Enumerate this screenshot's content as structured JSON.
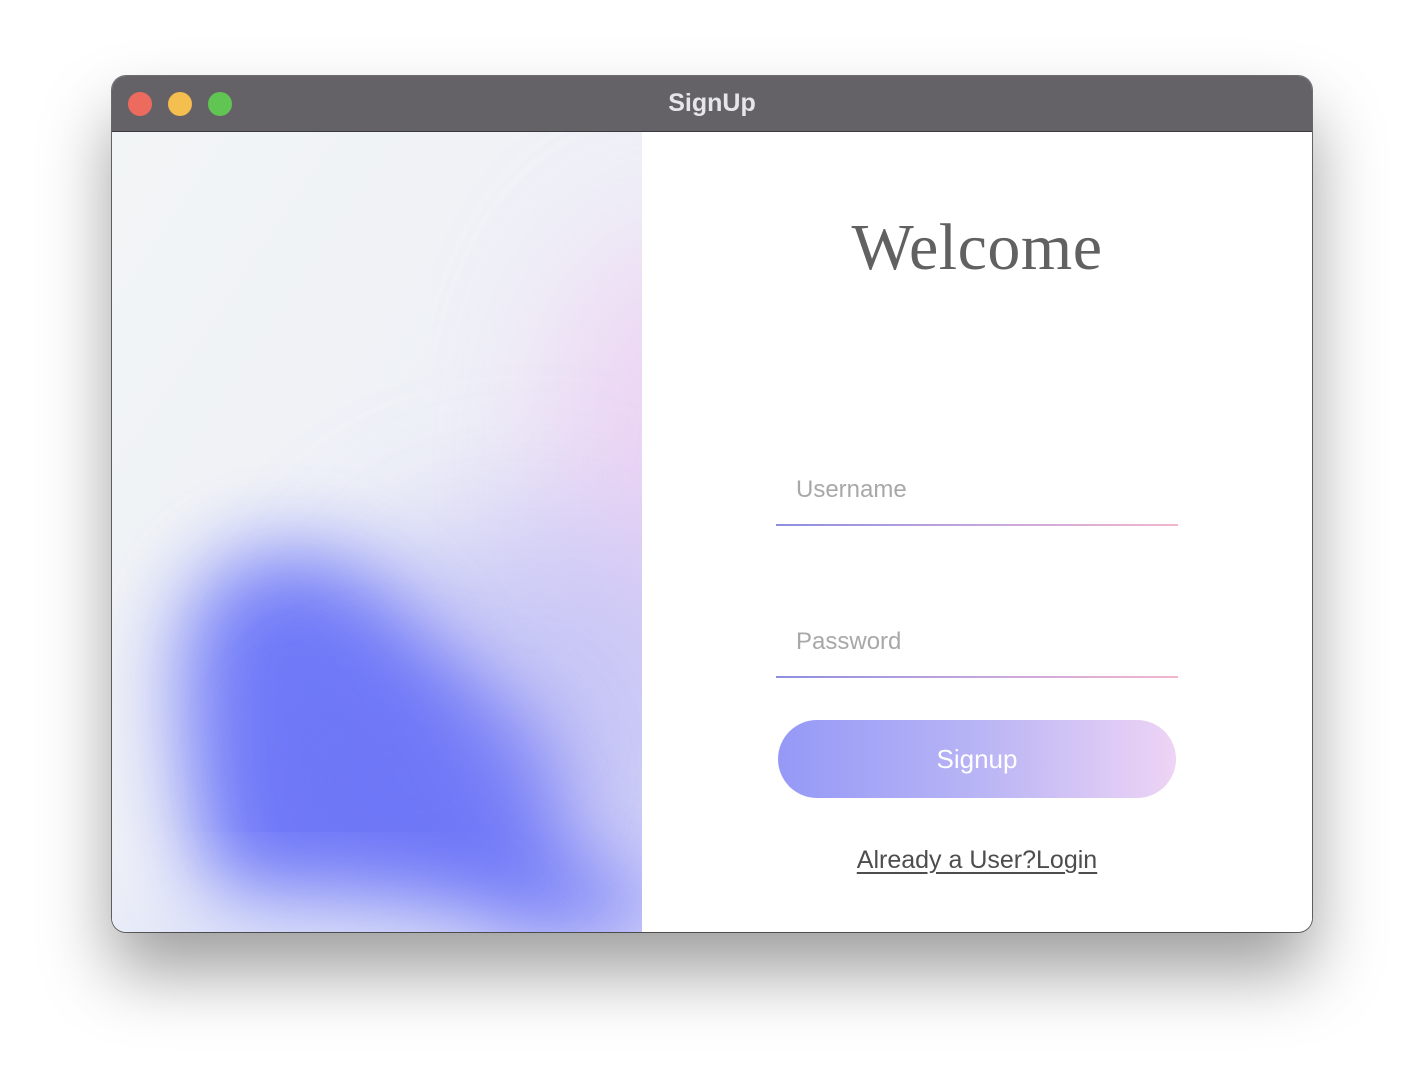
{
  "window": {
    "title": "SignUp"
  },
  "form": {
    "heading": "Welcome",
    "username_placeholder": "Username",
    "password_placeholder": "Password",
    "signup_label": "Signup",
    "login_link_label": "Already a User?Login"
  },
  "colors": {
    "titlebar": "#646267",
    "close": "#ed6a5e",
    "minimize": "#f5bf4f",
    "maximize": "#61c554",
    "accent_start": "#9599f6",
    "accent_end": "#eed4f5",
    "blob": "#6b74f8"
  }
}
